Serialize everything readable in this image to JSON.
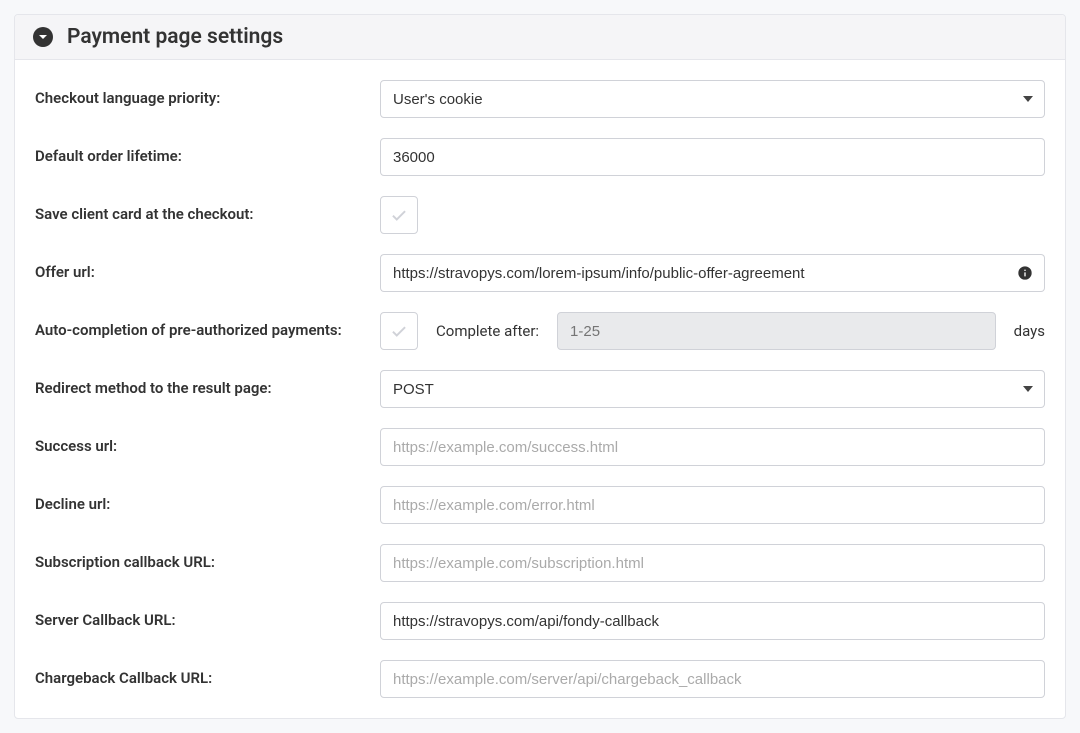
{
  "panel": {
    "title": "Payment page settings"
  },
  "labels": {
    "checkout_language_priority": "Checkout language priority:",
    "default_order_lifetime": "Default order lifetime:",
    "save_client_card": "Save client card at the checkout:",
    "offer_url": "Offer url:",
    "auto_completion": "Auto-completion of pre-authorized payments:",
    "complete_after": "Complete after:",
    "days": "days",
    "redirect_method": "Redirect method to the result page:",
    "success_url": "Success url:",
    "decline_url": "Decline url:",
    "subscription_callback_url": "Subscription callback URL:",
    "server_callback_url": "Server Callback URL:",
    "chargeback_callback_url": "Chargeback Callback URL:"
  },
  "values": {
    "checkout_language_priority": "User's cookie",
    "default_order_lifetime": "36000",
    "offer_url": "https://stravopys.com/lorem-ipsum/info/public-offer-agreement",
    "complete_after": "",
    "redirect_method": "POST",
    "success_url": "",
    "decline_url": "",
    "subscription_callback_url": "",
    "server_callback_url": "https://stravopys.com/api/fondy-callback",
    "chargeback_callback_url": ""
  },
  "placeholders": {
    "complete_after": "1-25",
    "success_url": "https://example.com/success.html",
    "decline_url": "https://example.com/error.html",
    "subscription_callback_url": "https://example.com/subscription.html",
    "chargeback_callback_url": "https://example.com/server/api/chargeback_callback"
  }
}
